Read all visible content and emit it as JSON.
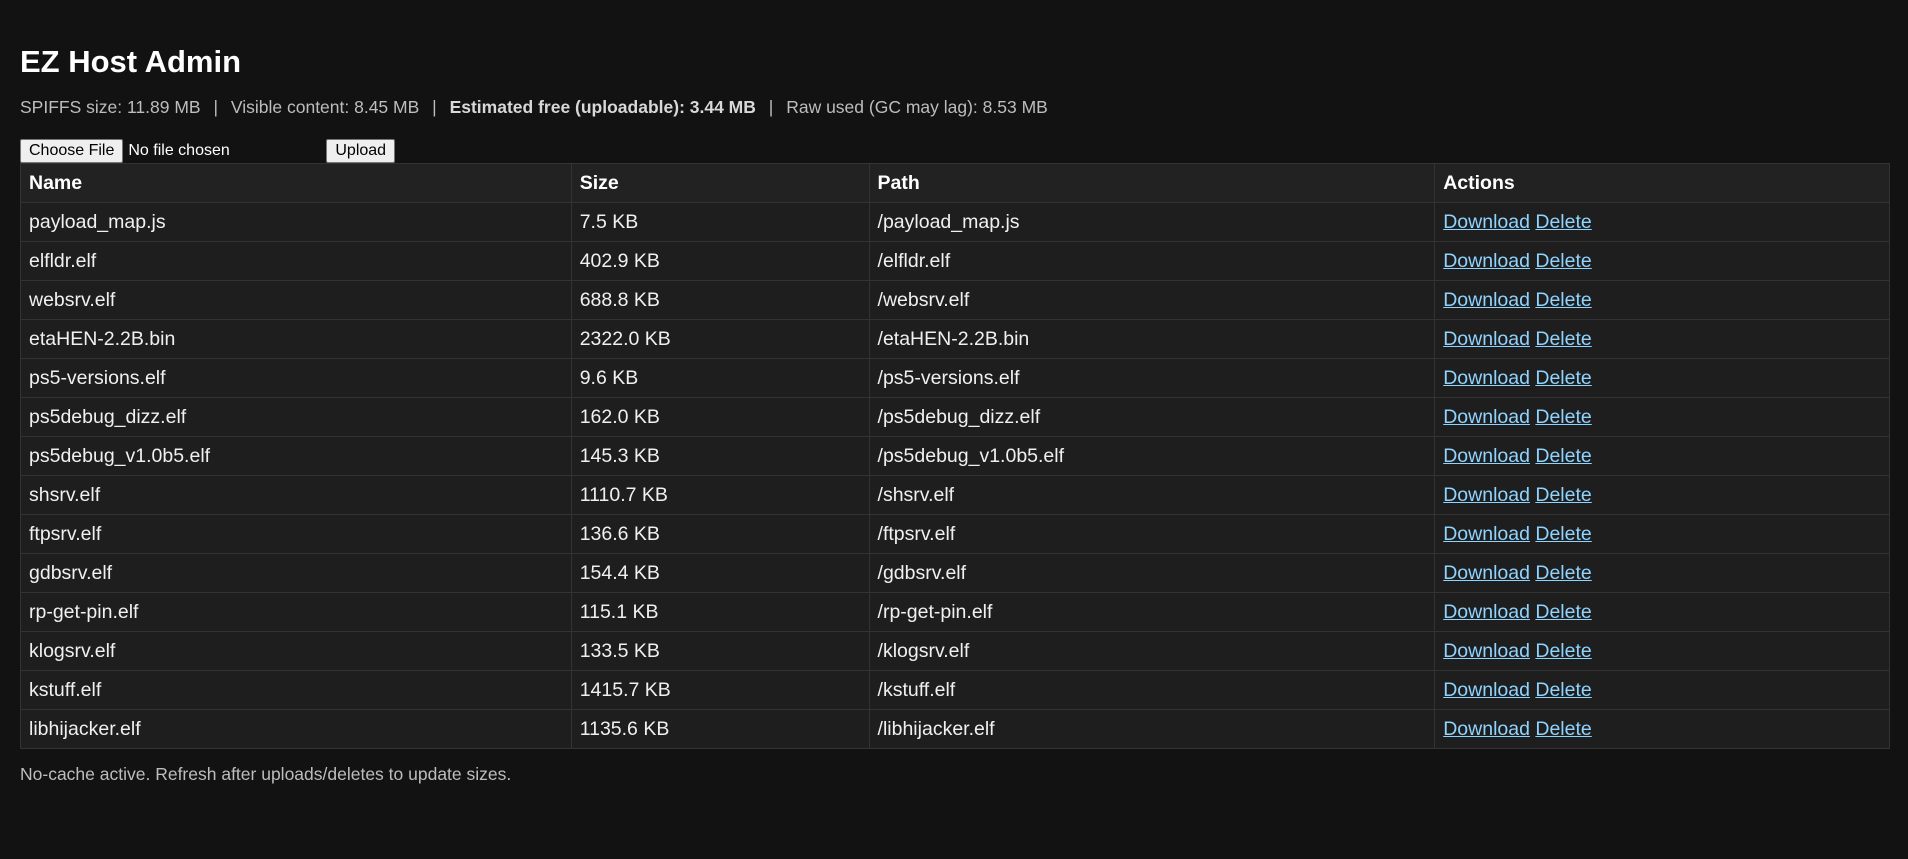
{
  "page": {
    "title": "EZ Host Admin",
    "stats": {
      "spiffs_size": "SPIFFS size: 11.89 MB",
      "visible_content": "Visible content: 8.45 MB",
      "estimated_free": "Estimated free (uploadable): 3.44 MB",
      "raw_used": "Raw used (GC may lag): 8.53 MB",
      "separator": "|"
    },
    "upload": {
      "choose_label": "Choose File",
      "file_status": "No file chosen",
      "upload_label": "Upload"
    },
    "table": {
      "headers": [
        "Name",
        "Size",
        "Path",
        "Actions"
      ],
      "download_label": "Download",
      "delete_label": "Delete",
      "rows": [
        {
          "name": "payload_map.js",
          "size": "7.5 KB",
          "path": "/payload_map.js"
        },
        {
          "name": "elfldr.elf",
          "size": "402.9 KB",
          "path": "/elfldr.elf"
        },
        {
          "name": "websrv.elf",
          "size": "688.8 KB",
          "path": "/websrv.elf"
        },
        {
          "name": "etaHEN-2.2B.bin",
          "size": "2322.0 KB",
          "path": "/etaHEN-2.2B.bin"
        },
        {
          "name": "ps5-versions.elf",
          "size": "9.6 KB",
          "path": "/ps5-versions.elf"
        },
        {
          "name": "ps5debug_dizz.elf",
          "size": "162.0 KB",
          "path": "/ps5debug_dizz.elf"
        },
        {
          "name": "ps5debug_v1.0b5.elf",
          "size": "145.3 KB",
          "path": "/ps5debug_v1.0b5.elf"
        },
        {
          "name": "shsrv.elf",
          "size": "1110.7 KB",
          "path": "/shsrv.elf"
        },
        {
          "name": "ftpsrv.elf",
          "size": "136.6 KB",
          "path": "/ftpsrv.elf"
        },
        {
          "name": "gdbsrv.elf",
          "size": "154.4 KB",
          "path": "/gdbsrv.elf"
        },
        {
          "name": "rp-get-pin.elf",
          "size": "115.1 KB",
          "path": "/rp-get-pin.elf"
        },
        {
          "name": "klogsrv.elf",
          "size": "133.5 KB",
          "path": "/klogsrv.elf"
        },
        {
          "name": "kstuff.elf",
          "size": "1415.7 KB",
          "path": "/kstuff.elf"
        },
        {
          "name": "libhijacker.elf",
          "size": "1135.6 KB",
          "path": "/libhijacker.elf"
        }
      ]
    },
    "footer": "No-cache active. Refresh after uploads/deletes to update sizes."
  },
  "colors": {
    "background": "#121212",
    "table_background": "#1e1e1e",
    "link": "#8fd3ff",
    "border": "#333333"
  }
}
